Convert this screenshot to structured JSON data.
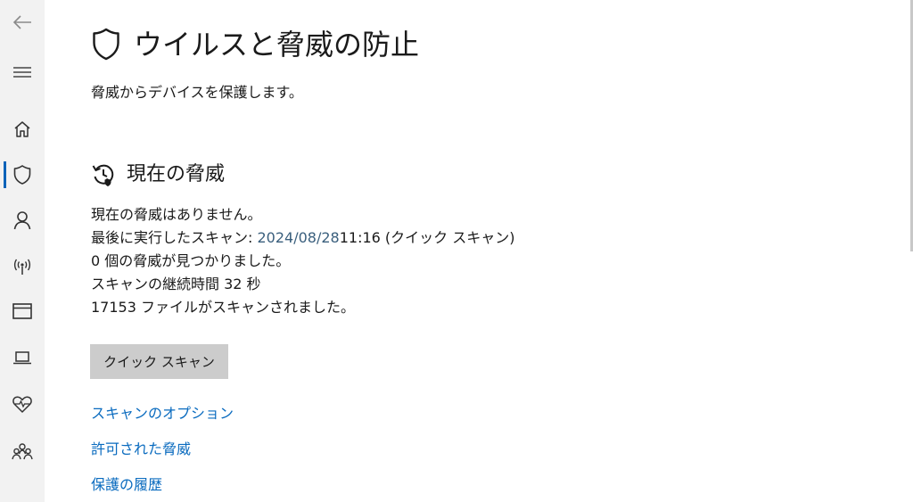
{
  "page": {
    "title": "ウイルスと脅威の防止",
    "subtitle": "脅威からデバイスを保護します。"
  },
  "current_threats": {
    "heading": "現在の脅威",
    "status": "現在の脅威はありません。",
    "last_scan_label": "最後に実行したスキャン: ",
    "last_scan_date": "2024/08/28",
    "last_scan_time": "11:16 (クイック スキャン)",
    "threats_found": "0 個の脅威が見つかりました。",
    "scan_duration": "スキャンの継続時間 32 秒",
    "files_scanned": "17153 ファイルがスキャンされました。"
  },
  "actions": {
    "quick_scan_label": "クイック スキャン"
  },
  "links": [
    {
      "label": "スキャンのオプション"
    },
    {
      "label": "許可された脅威"
    },
    {
      "label": "保護の履歴"
    }
  ],
  "nav": {
    "items": [
      {
        "icon": "back-arrow-icon"
      },
      {
        "icon": "hamburger-menu-icon"
      },
      {
        "icon": "home-icon"
      },
      {
        "icon": "shield-icon",
        "selected": true
      },
      {
        "icon": "person-icon"
      },
      {
        "icon": "wireless-antenna-icon"
      },
      {
        "icon": "app-browser-window-icon"
      },
      {
        "icon": "laptop-device-icon"
      },
      {
        "icon": "heart-pulse-icon"
      },
      {
        "icon": "family-people-icon"
      }
    ]
  },
  "colors": {
    "accent": "#0a63b9",
    "link": "#0a6bbf",
    "nav_background": "#f2f2f2",
    "button_background": "#cccccc"
  }
}
